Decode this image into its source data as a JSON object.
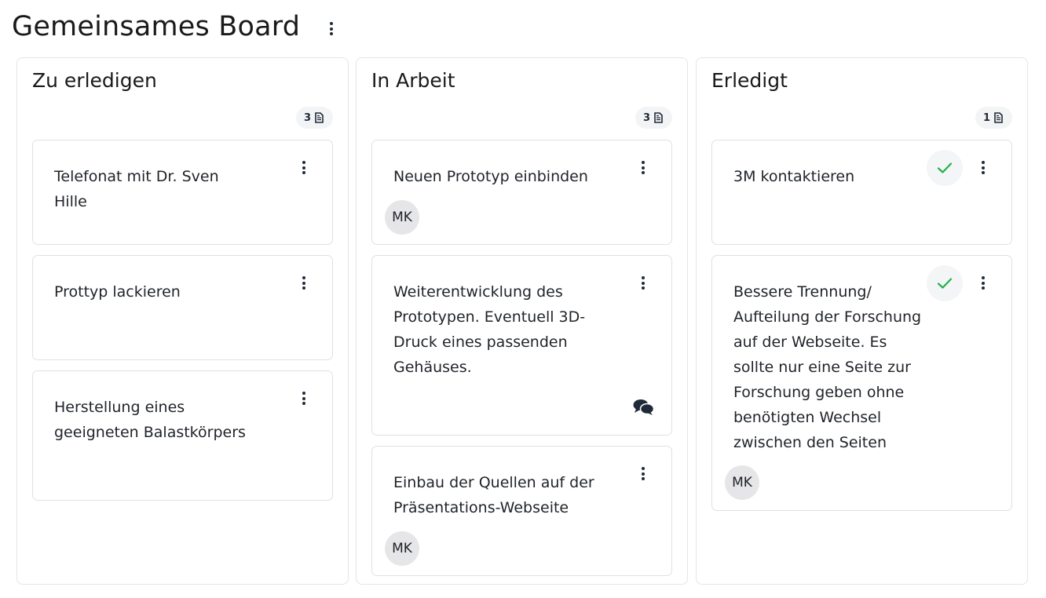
{
  "board": {
    "title": "Gemeinsames Board"
  },
  "colors": {
    "done_check": "#22b14c",
    "avatar_bg": "#e6e6e8",
    "badge_bg": "#f3f4f6"
  },
  "columns": [
    {
      "title": "Zu erledigen",
      "count": "3",
      "cards": [
        {
          "title": "Telefonat mit Dr. Sven Hille"
        },
        {
          "title": "Prottyp lackieren"
        },
        {
          "title": "Herstellung eines geeigneten Balastkörpers"
        }
      ]
    },
    {
      "title": "In Arbeit",
      "count": "3",
      "cards": [
        {
          "title": "Neuen Prototyp einbinden",
          "assignee": "MK"
        },
        {
          "title": "Weiterentwicklung des Prototypen. Eventuell 3D-Druck eines passenden Gehäuses.",
          "icon": "comments-icon"
        },
        {
          "title": "Einbau der Quellen auf der Präsentations-Webseite",
          "assignee": "MK"
        }
      ]
    },
    {
      "title": "Erledigt",
      "count": "1",
      "cards": [
        {
          "title": "3M kontaktieren",
          "icon": "check-icon"
        },
        {
          "title": "Bessere Trennung/ Aufteilung der Forschung auf der Webseite. Es sollte nur eine Seite zur Forschung geben ohne benötigten Wechsel zwischen den Seiten",
          "assignee": "MK",
          "icon": "check-icon"
        }
      ]
    }
  ]
}
